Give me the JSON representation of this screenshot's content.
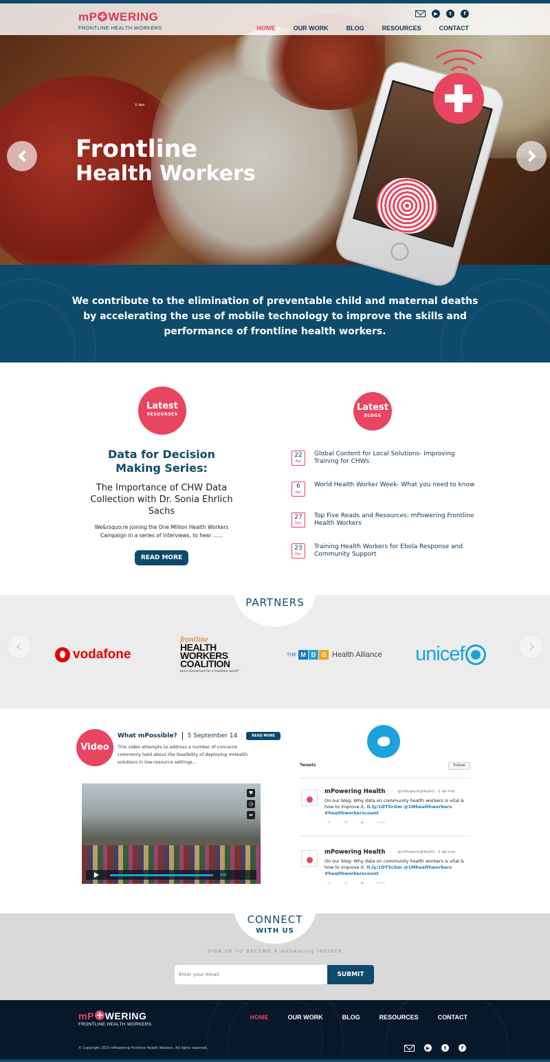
{
  "header": {
    "logo_name_part1": "mP",
    "logo_name_part2": "WERING",
    "logo_tagline": "FRONTLINE HEALTH WORKERS",
    "nav": [
      "HOME",
      "OUR WORK",
      "BLOG",
      "RESOURCES",
      "CONTACT"
    ],
    "active_nav": "HOME",
    "social_icons": [
      "mail-icon",
      "youtube-icon",
      "twitter-icon",
      "facebook-icon"
    ],
    "social_glyphs": [
      "",
      "▶",
      "t",
      "f"
    ]
  },
  "hero": {
    "title_line1": "Frontline",
    "title_line2": "Health Workers",
    "caption": "V deo"
  },
  "mission": {
    "text": "We contribute to the elimination of preventable child and maternal deaths by accelerating the use of mobile technology to improve the skills and performance of frontline health workers."
  },
  "latest_resources": {
    "badge_title": "Latest",
    "badge_sub": "RESOURSES",
    "title": "Data for Decision Making Series:",
    "subtitle": "The Importance of CHW Data Collection with Dr. Sonia Ehrlich Sachs",
    "excerpt": "We&rsquo;re joining the One Million Health Workers Campaign in a series of interviews, to hear ......",
    "button": "READ MORE"
  },
  "latest_blogs": {
    "badge_title": "Latest",
    "badge_sub": "BLOGS",
    "items": [
      {
        "day": "22",
        "month": "Apr",
        "title": "Global Content for Local Solutions- Improving Training for CHWs"
      },
      {
        "day": "6",
        "month": "Apr",
        "title": "World Health Worker Week- What you need to know"
      },
      {
        "day": "27",
        "month": "Mar",
        "title": "Top Five Reads and Resources: mPowering Frontline Health Workers"
      },
      {
        "day": "23",
        "month": "Mar",
        "title": "Training Health Workers for Ebola Response and Community Support"
      }
    ]
  },
  "partners": {
    "heading": "PARTNERS",
    "vodafone": "vodafone",
    "hwc_script": "frontline",
    "hwc_line1": "HEALTH",
    "hwc_line2": "WORKERS",
    "hwc_line3": "COALITION",
    "hwc_tagline": "best investment for a healthier world™",
    "mdg_the": "THE",
    "mdg_letters": [
      "M",
      "D",
      "G"
    ],
    "mdg_colors": [
      "#1b75bb",
      "#2aa0d8",
      "#f4a21b"
    ],
    "mdg_name": "Health Alliance",
    "unicef": "unicef"
  },
  "video": {
    "badge": "Video",
    "title": "What mPossible?",
    "date": "5 September 14",
    "button": "READ MORE",
    "description": "This video attempts to address a number of concerns commonly held about the feasibility of deploying mHealth solutions in low-resource settings...",
    "hd_label": "HD"
  },
  "tweets": {
    "label": "Tweets",
    "follow": "Follow",
    "items": [
      {
        "name": "mPowering Health",
        "handle": "@mPoweringHealth · 2 de mar",
        "text": "On our blog: Why data on community health workers is vital & how to improve it.",
        "links": "it.ly/1DT5cGm @1Mhealthworkers #healthworkerscount"
      },
      {
        "name": "mPowering Health",
        "handle": "@mPoweringHealth · 2 de mar",
        "text": "On our blog: Why data on community health workers is vital & how to improve it.",
        "links": "it.ly/1DT5cGm @1Mhealthworkers #healthworkerscount"
      }
    ]
  },
  "connect": {
    "line1": "CONNECT",
    "line2": "WITH US",
    "signup": "SIGN UP TO BECOME A mPowering INSIDER",
    "email_placeholder": "Enter your email",
    "submit": "SUBMIT"
  },
  "footer": {
    "logo_name_part1": "mP",
    "logo_name_part2": "WERING",
    "logo_tagline": "FRONTLINE HEALTH WORKERS",
    "nav": [
      "HOME",
      "OUR WORK",
      "BLOG",
      "RESOURCES",
      "CONTACT"
    ],
    "copyright": "© Copyright 2015 mPowering Frontline Health Workers. All rights reserved."
  },
  "colors": {
    "brand_red": "#e84560",
    "brand_navy": "#0e4a6b",
    "footer_bg": "#07182a",
    "twitter_blue": "#1ca3dc"
  }
}
